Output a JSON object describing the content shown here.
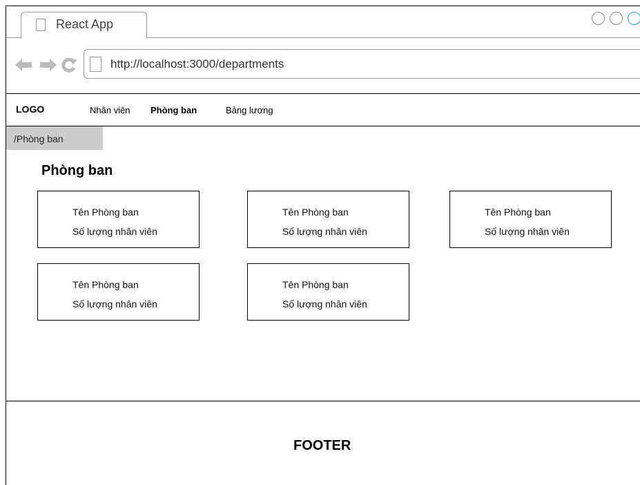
{
  "browser": {
    "tab_title": "React App",
    "url": "http://localhost:3000/departments"
  },
  "nav": {
    "logo": "LOGO",
    "items": [
      "Nhân viên",
      "Phòng ban",
      "Bảng lương"
    ],
    "active": "Phòng ban"
  },
  "breadcrumb": "/Phòng ban",
  "page_title": "Phòng ban",
  "departments": [
    {
      "name": "Tên Phòng ban",
      "count": "Số lượng nhân viên"
    },
    {
      "name": "Tên Phòng ban",
      "count": "Số lượng nhân viên"
    },
    {
      "name": "Tên Phòng ban",
      "count": "Số lượng nhân viên"
    },
    {
      "name": "Tên Phòng ban",
      "count": "Số lượng nhân viên"
    },
    {
      "name": "Tên Phòng ban",
      "count": "Số lượng nhân viên"
    }
  ],
  "footer": "FOOTER",
  "icons": {
    "back": "arrow-left-icon",
    "forward": "arrow-right-icon",
    "reload": "reload-icon",
    "page": "page-icon"
  },
  "colors": {
    "breadcrumb_bg": "#cccccc",
    "window_control_active": "#2a9ae0"
  }
}
